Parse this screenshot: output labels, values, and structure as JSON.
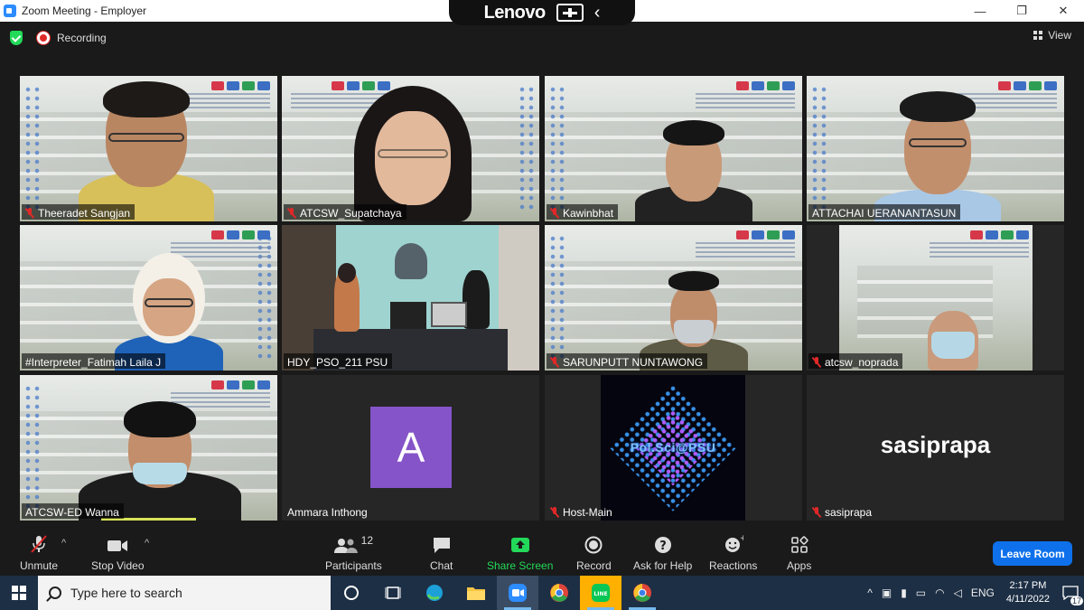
{
  "window": {
    "title": "Zoom Meeting - Employer",
    "minimize": "—",
    "maximize": "❐",
    "close": "✕"
  },
  "lenovo": {
    "brand": "Lenovo",
    "back": "‹"
  },
  "meeting": {
    "recording_label": "Recording",
    "view_label": "View"
  },
  "tiles": [
    {
      "name": "Theeradet  Sangjan",
      "muted": true
    },
    {
      "name": "ATCSW_Supatchaya",
      "muted": true
    },
    {
      "name": "Kawinbhat",
      "muted": true
    },
    {
      "name": "ATTACHAI UERANANTASUN",
      "muted": false
    },
    {
      "name": "#Interpreter_Fatimah Laila J",
      "muted": false
    },
    {
      "name": "HDY_PSO_211 PSU",
      "muted": false,
      "active_speaker": true
    },
    {
      "name": "SARUNPUTT NUNTAWONG",
      "muted": true
    },
    {
      "name": "atcsw_noprada",
      "muted": true
    },
    {
      "name": "ATCSW-ED Wanna",
      "muted": false
    },
    {
      "name": "Ammara Inthong",
      "muted": false,
      "avatar_letter": "A"
    },
    {
      "name": "Host-Main",
      "muted": true,
      "logo_text": "Pol.Sci@PSU"
    },
    {
      "name": "sasiprapa",
      "muted": true,
      "display_name": "sasiprapa"
    }
  ],
  "toolbar": {
    "unmute": "Unmute",
    "stop_video": "Stop Video",
    "participants": "Participants",
    "participants_count": "12",
    "chat": "Chat",
    "share_screen": "Share Screen",
    "record": "Record",
    "ask_for_help": "Ask for Help",
    "reactions": "Reactions",
    "apps": "Apps",
    "leave_room": "Leave Room"
  },
  "taskbar": {
    "search_placeholder": "Type here to search",
    "language": "ENG",
    "time": "2:17 PM",
    "date": "4/11/2022",
    "notifications": "17"
  },
  "colors": {
    "accent_blue": "#0e71eb",
    "share_green": "#23d959",
    "muted_red": "#e02828",
    "speaker_yellow": "#d8e35a",
    "avatar_purple": "#8554c8"
  }
}
